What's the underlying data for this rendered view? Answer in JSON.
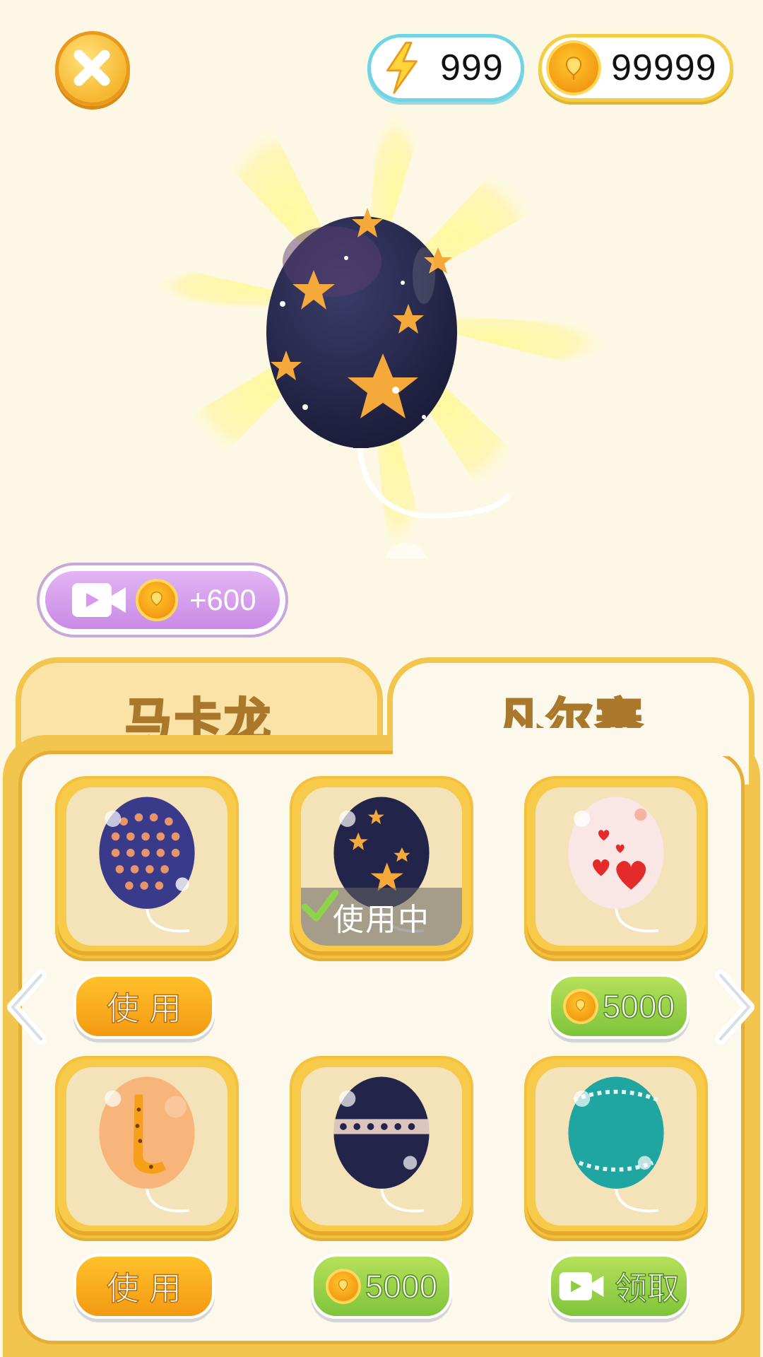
{
  "stats": {
    "energy": "999",
    "coins": "99999"
  },
  "video_reward": {
    "label": "+600"
  },
  "tabs": [
    {
      "label": "马卡龙",
      "active": false
    },
    {
      "label": "凡尔赛",
      "active": true
    }
  ],
  "grid": {
    "in_use_label": "使用中",
    "items": [
      {
        "name": "polka-dot-balloon",
        "action": "use",
        "action_label": "使用"
      },
      {
        "name": "star-balloon",
        "action": "in-use",
        "action_label": ""
      },
      {
        "name": "heart-balloon",
        "action": "buy",
        "action_label": "5000"
      },
      {
        "name": "giraffe-balloon",
        "action": "use",
        "action_label": "使用"
      },
      {
        "name": "lace-balloon",
        "action": "buy",
        "action_label": "5000"
      },
      {
        "name": "teal-lace-balloon",
        "action": "video",
        "action_label": "领取"
      }
    ]
  },
  "colors": {
    "accent": "#f2c64e",
    "green": "#8ccc40",
    "orange": "#f5a818",
    "purple": "#d49aec"
  },
  "icons": [
    "close-icon",
    "lightning-icon",
    "coin-icon",
    "video-icon",
    "check-icon",
    "arrow-left-icon",
    "arrow-right-icon"
  ]
}
